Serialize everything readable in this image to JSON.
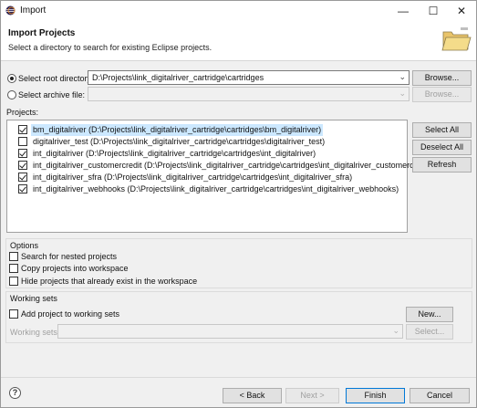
{
  "window": {
    "title": "Import",
    "icon": "eclipse-icon",
    "minimize_glyph": "—",
    "maximize_glyph": "☐",
    "close_glyph": "✕"
  },
  "header": {
    "title": "Import Projects",
    "description": "Select a directory to search for existing Eclipse projects.",
    "icon": "folder-icon"
  },
  "source": {
    "root_label": "Select root directory:",
    "root_selected": true,
    "root_value": "D:\\Projects\\link_digitalriver_cartridge\\cartridges",
    "root_browse": "Browse...",
    "archive_label": "Select archive file:",
    "archive_selected": false,
    "archive_value": "",
    "archive_browse": "Browse..."
  },
  "projects": {
    "label": "Projects:",
    "items": [
      {
        "text": "bm_digitalriver (D:\\Projects\\link_digitalriver_cartridge\\cartridges\\bm_digitalriver)",
        "checked": true,
        "selected": true
      },
      {
        "text": "digitalriver_test (D:\\Projects\\link_digitalriver_cartridge\\cartridges\\digitalriver_test)",
        "checked": false,
        "selected": false
      },
      {
        "text": "int_digitalriver (D:\\Projects\\link_digitalriver_cartridge\\cartridges\\int_digitalriver)",
        "checked": true,
        "selected": false
      },
      {
        "text": "int_digitalriver_customercredit (D:\\Projects\\link_digitalriver_cartridge\\cartridges\\int_digitalriver_customercredit)",
        "checked": true,
        "selected": false
      },
      {
        "text": "int_digitalriver_sfra (D:\\Projects\\link_digitalriver_cartridge\\cartridges\\int_digitalriver_sfra)",
        "checked": true,
        "selected": false
      },
      {
        "text": "int_digitalriver_webhooks (D:\\Projects\\link_digitalriver_cartridge\\cartridges\\int_digitalriver_webhooks)",
        "checked": true,
        "selected": false
      }
    ],
    "select_all": "Select All",
    "deselect_all": "Deselect All",
    "refresh": "Refresh"
  },
  "options": {
    "label": "Options",
    "nested": "Search for nested projects",
    "copy": "Copy projects into workspace",
    "hide": "Hide projects that already exist in the workspace"
  },
  "working_sets": {
    "label": "Working sets",
    "add": "Add project to working sets",
    "new": "New...",
    "sets_label": "Working sets:",
    "select": "Select..."
  },
  "footer": {
    "help": "?",
    "back": "< Back",
    "next": "Next >",
    "finish": "Finish",
    "cancel": "Cancel"
  },
  "colors": {
    "accent": "#0078d7",
    "selection": "#cce8ff"
  }
}
